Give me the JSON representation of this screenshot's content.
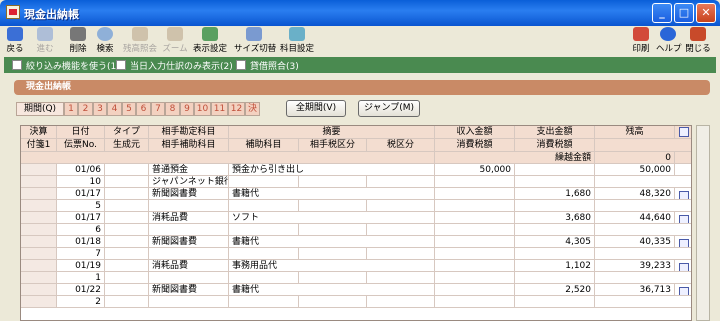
{
  "window": {
    "title": "現金出納帳",
    "minimize": "_",
    "maximize": "□",
    "close": "✕"
  },
  "toolbar": {
    "back": "戻る",
    "forward": "進む",
    "delete": "削除",
    "search": "検索",
    "inquiry": "残高照会",
    "zoom": "ズーム",
    "display_settings": "表示設定",
    "size_switch": "サイズ切替",
    "account_settings": "科目設定",
    "print": "印刷",
    "help": "ヘルプ",
    "close": "閉じる"
  },
  "options": {
    "filter": "絞り込み機能を使う(1)",
    "today_only": "当日入力仕訳のみ表示(2)",
    "lending": "貸借照合(3)"
  },
  "section_title": "現金出納帳",
  "period": {
    "label": "期間(Q)",
    "months": [
      "1",
      "2",
      "3",
      "4",
      "5",
      "6",
      "7",
      "8",
      "9",
      "10",
      "11",
      "12",
      "決"
    ],
    "all_period_button": "全期間(V)",
    "jump_button": "ジャンプ(M)"
  },
  "table": {
    "headers_top": [
      "決算",
      "日付",
      "タイプ",
      "相手勘定科目",
      "摘要",
      "収入金額",
      "支出金額",
      "残高"
    ],
    "headers_bottom": [
      "付箋1",
      "伝票No.",
      "生成元",
      "相手補助科目",
      "補助科目",
      "相手税区分",
      "税区分",
      "消費税額",
      "消費税額"
    ],
    "carryover_label": "繰越金額",
    "carryover_value": "0",
    "rows": [
      {
        "date": "01/06",
        "no": "10",
        "account": "普通預金",
        "sub_account": "ジャパンネット銀行",
        "summary": "預金から引き出し",
        "income": "50,000",
        "expense": "",
        "balance": "50,000"
      },
      {
        "date": "01/17",
        "no": "5",
        "account": "新聞図書費",
        "sub_account": "",
        "summary": "書籍代",
        "income": "",
        "expense": "1,680",
        "balance": "48,320"
      },
      {
        "date": "01/17",
        "no": "6",
        "account": "消耗品費",
        "sub_account": "",
        "summary": "ソフト",
        "income": "",
        "expense": "3,680",
        "balance": "44,640"
      },
      {
        "date": "01/18",
        "no": "7",
        "account": "新聞図書費",
        "sub_account": "",
        "summary": "書籍代",
        "income": "",
        "expense": "4,305",
        "balance": "40,335"
      },
      {
        "date": "01/19",
        "no": "1",
        "account": "消耗品費",
        "sub_account": "",
        "summary": "事務用品代",
        "income": "",
        "expense": "1,102",
        "balance": "39,233"
      },
      {
        "date": "01/22",
        "no": "2",
        "account": "新聞図書費",
        "sub_account": "",
        "summary": "書籍代",
        "income": "",
        "expense": "2,520",
        "balance": "36,713"
      }
    ]
  }
}
